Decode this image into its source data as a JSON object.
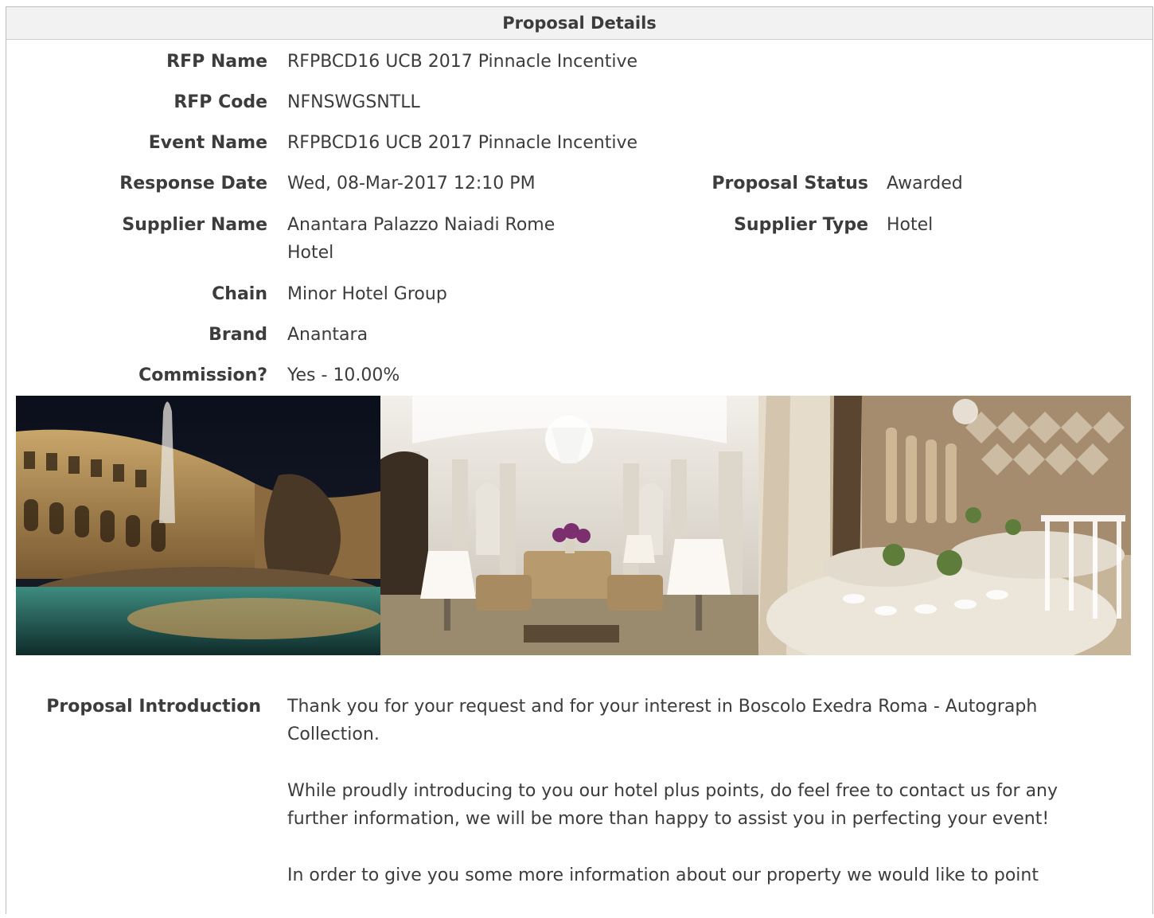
{
  "panel": {
    "title": "Proposal Details"
  },
  "details": {
    "rfp_name_label": "RFP Name",
    "rfp_name": "RFPBCD16 UCB 2017 Pinnacle Incentive",
    "rfp_code_label": "RFP Code",
    "rfp_code": "NFNSWGSNTLL",
    "event_name_label": "Event Name",
    "event_name": "RFPBCD16 UCB 2017 Pinnacle Incentive",
    "response_date_label": "Response Date",
    "response_date": "Wed, 08-Mar-2017 12:10 PM",
    "proposal_status_label": "Proposal Status",
    "proposal_status": "Awarded",
    "supplier_name_label": "Supplier Name",
    "supplier_name_line1": "Anantara Palazzo Naiadi Rome",
    "supplier_name_line2": "Hotel",
    "supplier_type_label": "Supplier Type",
    "supplier_type": "Hotel",
    "chain_label": "Chain",
    "chain": "Minor Hotel Group",
    "brand_label": "Brand",
    "brand": "Anantara",
    "commission_label": "Commission?",
    "commission": "Yes - 10.00%"
  },
  "photos": [
    "hotel-exterior-fountain-photo",
    "hotel-lobby-chandelier-photo",
    "hotel-banquet-hall-photo"
  ],
  "intro": {
    "label": "Proposal Introduction",
    "paragraph1": "Thank you for your request and for your interest in Boscolo Exedra Roma - Autograph Collection.",
    "paragraph2": "While proudly introducing to you our hotel plus points, do feel free to contact us for any further information, we will be more than happy to assist you in perfecting your event!",
    "paragraph3": "In order to give you some more information about our property we would like to point"
  },
  "colors": {
    "border": "#bdbdbd",
    "header_bg": "#f2f2f2",
    "text": "#3c3c3c"
  }
}
